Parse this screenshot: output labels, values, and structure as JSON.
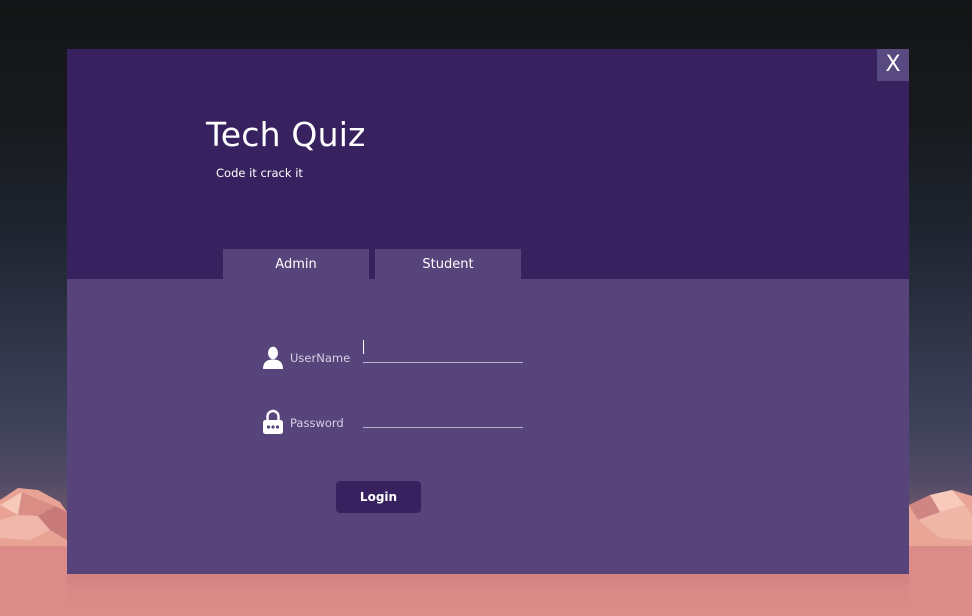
{
  "window": {
    "close_label": "X",
    "title": "Tech Quiz",
    "subtitle": "Code it crack it"
  },
  "tabs": [
    {
      "label": "Admin"
    },
    {
      "label": "Student"
    }
  ],
  "form": {
    "username": {
      "label": "UserName",
      "value": ""
    },
    "password": {
      "label": "Password",
      "value": ""
    },
    "login_label": "Login"
  },
  "colors": {
    "header": "#37215e",
    "panel": "#56447b",
    "close_button": "#584a80",
    "login_button": "#37215e",
    "text": "#ffffff"
  }
}
